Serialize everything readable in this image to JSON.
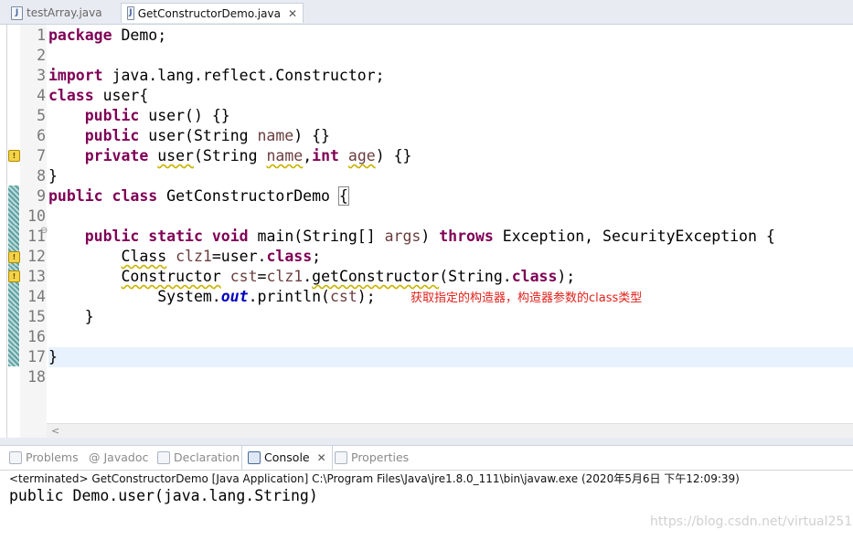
{
  "tabs": [
    {
      "label": "testArray.java",
      "active": false
    },
    {
      "label": "GetConstructorDemo.java",
      "active": true
    }
  ],
  "editor": {
    "line_numbers": [
      "1",
      "2",
      "3",
      "4",
      "5",
      "6",
      "7",
      "8",
      "9",
      "10",
      "11",
      "12",
      "13",
      "14",
      "15",
      "16",
      "17",
      "18"
    ],
    "annotation": "获取指定的构造器，构造器参数的class类型"
  },
  "panel": {
    "tabs": [
      "Problems",
      "Javadoc",
      "Declaration",
      "Console",
      "Properties"
    ],
    "active_tab": "Console",
    "status": "<terminated> GetConstructorDemo [Java Application] C:\\Program Files\\Java\\jre1.8.0_111\\bin\\javaw.exe (2020年5月6日 下午12:09:39)",
    "output": "public Demo.user(java.lang.String)"
  },
  "watermark": "https://blog.csdn.net/virtual251",
  "colors": {
    "keyword": "#7f0055",
    "local_var": "#6a3e3e",
    "field": "#0000c0",
    "annotation": "#e0201a"
  }
}
